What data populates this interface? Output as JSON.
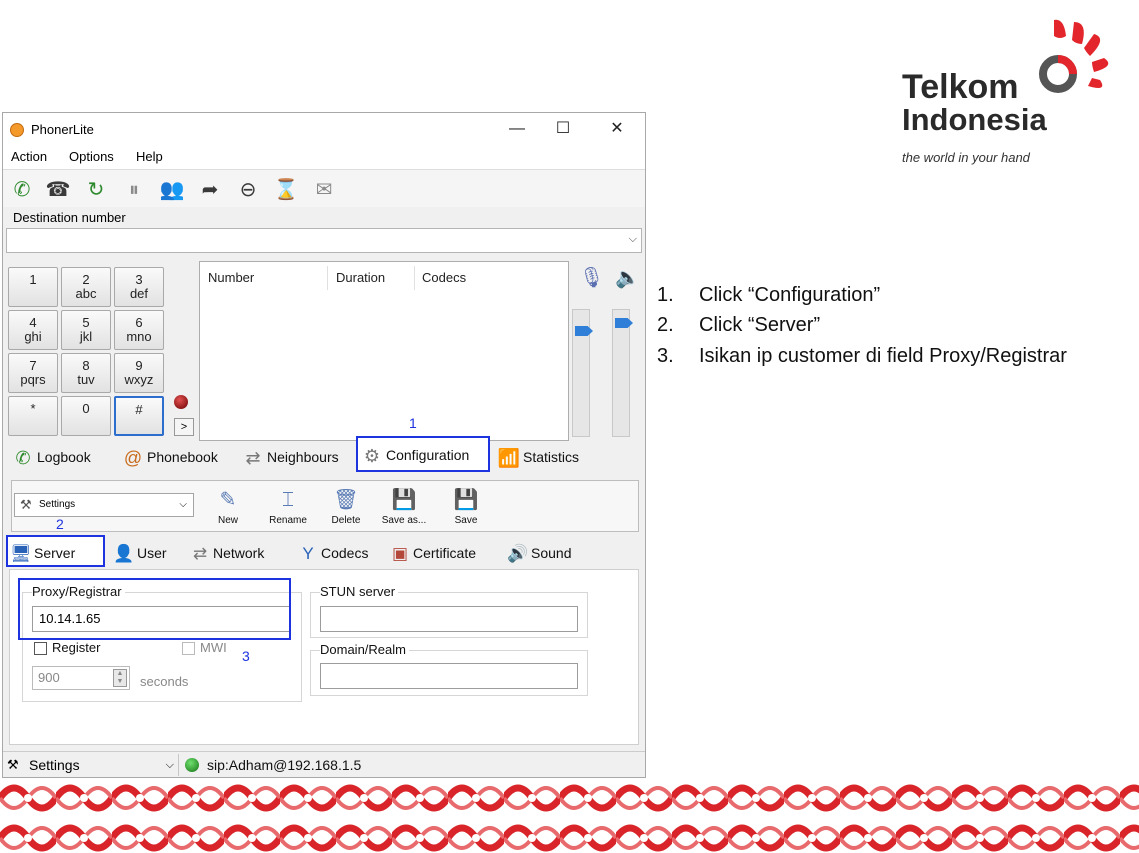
{
  "window": {
    "title": "PhonerLite",
    "controls": {
      "minimize": "—",
      "maximize": "☐",
      "close": "✕"
    }
  },
  "menu": [
    "Action",
    "Options",
    "Help"
  ],
  "toolbar_icons": [
    "call-icon",
    "answer-icon",
    "redial-icon",
    "hold-icon",
    "conference-icon",
    "transfer-icon",
    "hangup-icon",
    "callwait-icon",
    "voicemail-icon"
  ],
  "destination": {
    "label": "Destination number",
    "value": ""
  },
  "keypad": [
    {
      "main": "1",
      "sub": ""
    },
    {
      "main": "2",
      "sub": "abc"
    },
    {
      "main": "3",
      "sub": "def"
    },
    {
      "main": "4",
      "sub": "ghi"
    },
    {
      "main": "5",
      "sub": "jkl"
    },
    {
      "main": "6",
      "sub": "mno"
    },
    {
      "main": "7",
      "sub": "pqrs"
    },
    {
      "main": "8",
      "sub": "tuv"
    },
    {
      "main": "9",
      "sub": "wxyz"
    },
    {
      "main": "*",
      "sub": ""
    },
    {
      "main": "0",
      "sub": ""
    },
    {
      "main": "#",
      "sub": ""
    }
  ],
  "keypad_more": ">",
  "call_list": {
    "columns": [
      "Number",
      "Duration",
      "Codecs"
    ]
  },
  "main_tabs": [
    "Logbook",
    "Phonebook",
    "Neighbours",
    "Configuration",
    "Statistics"
  ],
  "profile": {
    "selected": "Settings",
    "buttons": [
      "New",
      "Rename",
      "Delete",
      "Save as...",
      "Save"
    ]
  },
  "sub_tabs": [
    "Server",
    "User",
    "Network",
    "Codecs",
    "Certificate",
    "Sound"
  ],
  "server": {
    "proxy_label": "Proxy/Registrar",
    "proxy_value": "10.14.1.65",
    "register_label": "Register",
    "register_checked": false,
    "mwi_label": "MWI",
    "mwi_checked": false,
    "interval_value": "900",
    "interval_unit": "seconds",
    "stun_label": "STUN server",
    "stun_value": "",
    "domain_label": "Domain/Realm",
    "domain_value": ""
  },
  "status_bar": {
    "profile": "Settings",
    "sip": "sip:Adham@192.168.1.5"
  },
  "annotations": [
    "1",
    "2",
    "3"
  ],
  "brand": {
    "line1": "Telkom",
    "line2": "Indonesia",
    "tagline": "the world in your hand",
    "accent": "#e3262b"
  },
  "steps": [
    {
      "n": "1.",
      "text": "Click “Configuration”"
    },
    {
      "n": "2.",
      "text": "Click “Server”"
    },
    {
      "n": "3.",
      "text": "Isikan ip customer  di field Proxy/Registrar"
    }
  ]
}
